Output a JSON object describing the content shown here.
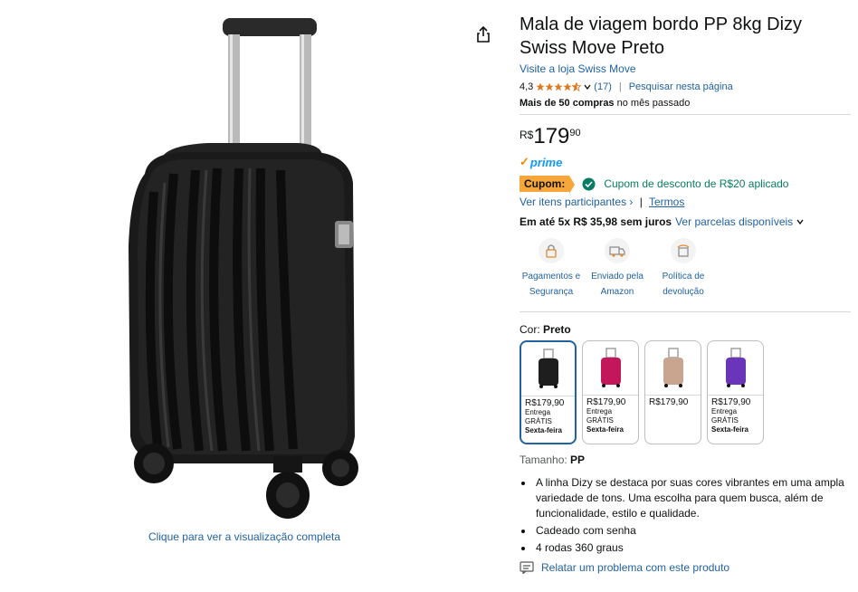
{
  "product": {
    "title": "Mala de viagem bordo PP 8kg Dizy Swiss Move Preto",
    "store_link": "Visite a loja Swiss Move",
    "rating": "4,3",
    "rating_stars": 4.3,
    "review_count": "(17)",
    "search_page": "Pesquisar nesta página",
    "bought_bold": "Mais de 50 compras",
    "bought_rest": " no mês passado"
  },
  "price": {
    "currency": "R$",
    "integer": "179",
    "decimals": "90"
  },
  "prime": {
    "label": "prime"
  },
  "coupon": {
    "badge": "Cupom:",
    "applied": "Cupom de desconto de R$20 aplicado",
    "participants": "Ver itens participantes ›",
    "separator": "|",
    "terms": "Termos"
  },
  "installments": {
    "bold": "Em até 5x R$ 35,98 sem juros",
    "link": "Ver parcelas disponíveis"
  },
  "features": [
    {
      "label": "Pagamentos e Segurança",
      "icon": "lock-icon"
    },
    {
      "label": "Enviado pela Amazon",
      "icon": "truck-icon"
    },
    {
      "label": "Política de devolução",
      "icon": "return-box-icon"
    }
  ],
  "color": {
    "label": "Cor:",
    "value": "Preto",
    "options": [
      {
        "name": "Preto",
        "price": "R$179,90",
        "delivery1": "Entrega",
        "delivery2": "GRÁTIS",
        "delivery3": "Sexta-feira",
        "hex": "#1e1e1e",
        "selected": true
      },
      {
        "name": "Rosa",
        "price": "R$179,90",
        "delivery1": "Entrega",
        "delivery2": "GRÁTIS",
        "delivery3": "Sexta-feira",
        "hex": "#c2185b",
        "selected": false
      },
      {
        "name": "Champagne",
        "price": "R$179,90",
        "delivery1": "",
        "delivery2": "",
        "delivery3": "",
        "hex": "#c9a48f",
        "selected": false
      },
      {
        "name": "Roxo",
        "price": "R$179,90",
        "delivery1": "Entrega",
        "delivery2": "GRÁTIS",
        "delivery3": "Sexta-feira",
        "hex": "#6a35b8",
        "selected": false
      }
    ]
  },
  "size": {
    "label": "Tamanho:",
    "value": "PP"
  },
  "bullets": [
    "A linha Dizy se destaca por suas cores vibrantes em uma ampla variedade de tons. Uma escolha para quem busca, além de funcionalidade, estilo e qualidade.",
    "Cadeado com senha",
    "4 rodas 360 graus"
  ],
  "report": "Relatar um problema com este produto",
  "image_caption": "Clique para ver a visualização completa",
  "colors": {
    "link": "#2162a1",
    "coupon": "#f7a73a",
    "green": "#067d62",
    "prime": "#1399ff"
  }
}
